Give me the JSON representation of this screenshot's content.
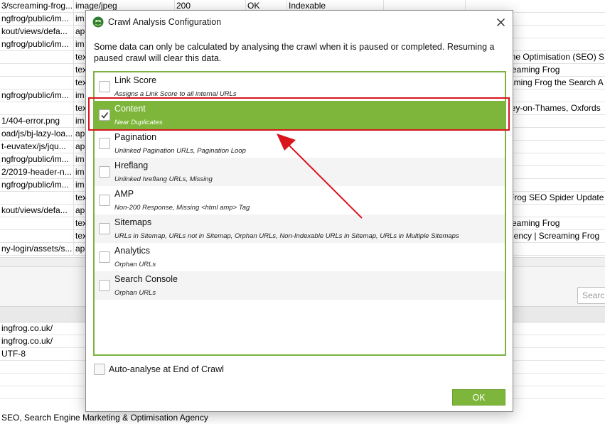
{
  "background": {
    "rows": [
      {
        "url": "3/screaming-frog...",
        "type": "image/jpeg",
        "status": "200",
        "ok": "OK",
        "indexable": "Indexable",
        "title": ""
      },
      {
        "url": "ngfrog/public/im...",
        "type": "im",
        "status": "",
        "ok": "",
        "indexable": "",
        "title": ""
      },
      {
        "url": "kout/views/defa...",
        "type": "ap",
        "status": "",
        "ok": "",
        "indexable": "",
        "title": ""
      },
      {
        "url": "ngfrog/public/im...",
        "type": "im",
        "status": "",
        "ok": "",
        "indexable": "",
        "title": ""
      },
      {
        "url": "",
        "type": "tex",
        "status": "",
        "ok": "",
        "indexable": "",
        "title": "ine Optimisation (SEO) S"
      },
      {
        "url": "",
        "type": "tex",
        "status": "",
        "ok": "",
        "indexable": "",
        "title": "reaming Frog"
      },
      {
        "url": "",
        "type": "tex",
        "status": "",
        "ok": "",
        "indexable": "",
        "title": "aming Frog the Search A"
      },
      {
        "url": "ngfrog/public/im...",
        "type": "im",
        "status": "",
        "ok": "",
        "indexable": "",
        "title": ""
      },
      {
        "url": "",
        "type": "tex",
        "status": "",
        "ok": "",
        "indexable": "",
        "title": "ley-on-Thames, Oxfords"
      },
      {
        "url": "1/404-error.png",
        "type": "im",
        "status": "",
        "ok": "",
        "indexable": "",
        "title": ""
      },
      {
        "url": "oad/js/bj-lazy-loa...",
        "type": "ap",
        "status": "",
        "ok": "",
        "indexable": "",
        "title": ""
      },
      {
        "url": "t-euvatex/js/jqu...",
        "type": "ap",
        "status": "",
        "ok": "",
        "indexable": "",
        "title": ""
      },
      {
        "url": "ngfrog/public/im...",
        "type": "im",
        "status": "",
        "ok": "",
        "indexable": "",
        "title": ""
      },
      {
        "url": "2/2019-header-n...",
        "type": "im",
        "status": "",
        "ok": "",
        "indexable": "",
        "title": ""
      },
      {
        "url": "ngfrog/public/im...",
        "type": "im",
        "status": "",
        "ok": "",
        "indexable": "",
        "title": ""
      },
      {
        "url": "",
        "type": "tex",
        "status": "",
        "ok": "",
        "indexable": "",
        "title": "Frog SEO Spider Update"
      },
      {
        "url": "kout/views/defa...",
        "type": "ap",
        "status": "",
        "ok": "",
        "indexable": "",
        "title": ""
      },
      {
        "url": "",
        "type": "tex",
        "status": "",
        "ok": "",
        "indexable": "",
        "title": "reaming Frog"
      },
      {
        "url": "",
        "type": "tex",
        "status": "",
        "ok": "",
        "indexable": "",
        "title": "gency | Screaming Frog"
      },
      {
        "url": "ny-login/assets/s...",
        "type": "ap",
        "status": "",
        "ok": "",
        "indexable": "",
        "title": ""
      }
    ],
    "search_placeholder": "Search",
    "lower_rows": [
      "ingfrog.co.uk/",
      "ingfrog.co.uk/",
      "UTF-8",
      "",
      "",
      ""
    ],
    "bottom_text": "SEO, Search Engine Marketing & Optimisation Agency"
  },
  "dialog": {
    "title": "Crawl Analysis Configuration",
    "intro": "Some data can only be calculated by analysing the crawl when it is paused or completed. Resuming a paused crawl will clear this data.",
    "items": [
      {
        "name": "Link Score",
        "desc": "Assigns a Link Score to all internal URLs",
        "checked": false
      },
      {
        "name": "Content",
        "desc": "Near Duplicates",
        "checked": true
      },
      {
        "name": "Pagination",
        "desc": "Unlinked Pagination URLs, Pagination Loop",
        "checked": false
      },
      {
        "name": "Hreflang",
        "desc": "Unlinked hreflang URLs, Missing",
        "checked": false
      },
      {
        "name": "AMP",
        "desc": "Non-200 Response, Missing <html amp> Tag",
        "checked": false
      },
      {
        "name": "Sitemaps",
        "desc": "URLs in Sitemap, URLs not in Sitemap, Orphan URLs, Non-Indexable URLs in Sitemap, URLs in Multiple Sitemaps",
        "checked": false
      },
      {
        "name": "Analytics",
        "desc": "Orphan URLs",
        "checked": false
      },
      {
        "name": "Search Console",
        "desc": "Orphan URLs",
        "checked": false
      }
    ],
    "auto_analyse_label": "Auto-analyse at End of Crawl",
    "auto_analyse_checked": false,
    "ok_label": "OK"
  },
  "colors": {
    "accent_green": "#7db63a",
    "panel_border": "#7cb342",
    "annotation_red": "#d9161c"
  },
  "icons": {
    "app": "frog-logo-icon",
    "close": "close-icon",
    "check": "checkmark-icon"
  }
}
